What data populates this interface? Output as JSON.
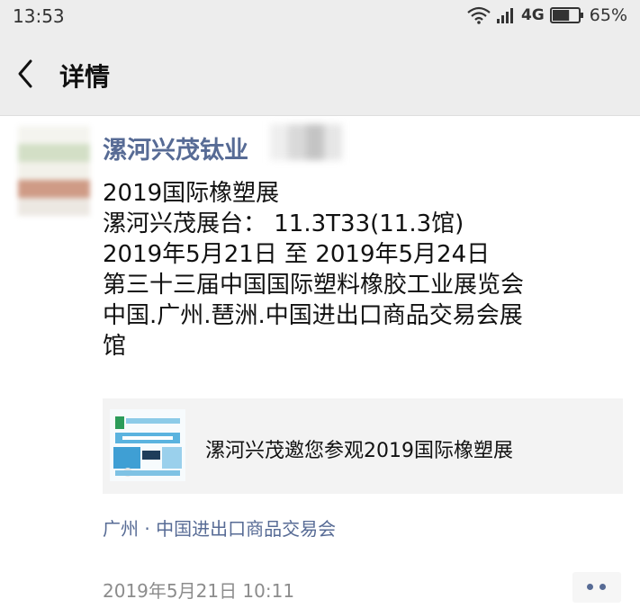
{
  "status_bar": {
    "time": "13:53",
    "network": "4G",
    "battery": "65%",
    "battery_level": 0.65,
    "icons": [
      "wifi-icon",
      "signal-icon",
      "battery-icon"
    ]
  },
  "nav": {
    "back_icon": "back-icon",
    "title": "详情"
  },
  "post": {
    "author": "漯河兴茂钛业",
    "lines": [
      "2019国际橡塑展",
      "漯河兴茂展台：  11.3T33(11.3馆)",
      "2019年5月21日 至 2019年5月24日",
      "第三十三届中国国际塑料橡胶工业展览会",
      "中国.广州.琶洲.中国进出口商品交易会展",
      "馆"
    ],
    "share_card": {
      "title": "漯河兴茂邀您参观2019国际橡塑展"
    },
    "location": "广州  ·  中国进出口商品交易会",
    "timestamp": "2019年5月21日 10:11",
    "more_icon": "more-dots-icon"
  },
  "colors": {
    "link": "#576b95",
    "bar_background": "#ededed",
    "card_background": "#f3f3f3",
    "timestamp": "#8c8c8c"
  }
}
